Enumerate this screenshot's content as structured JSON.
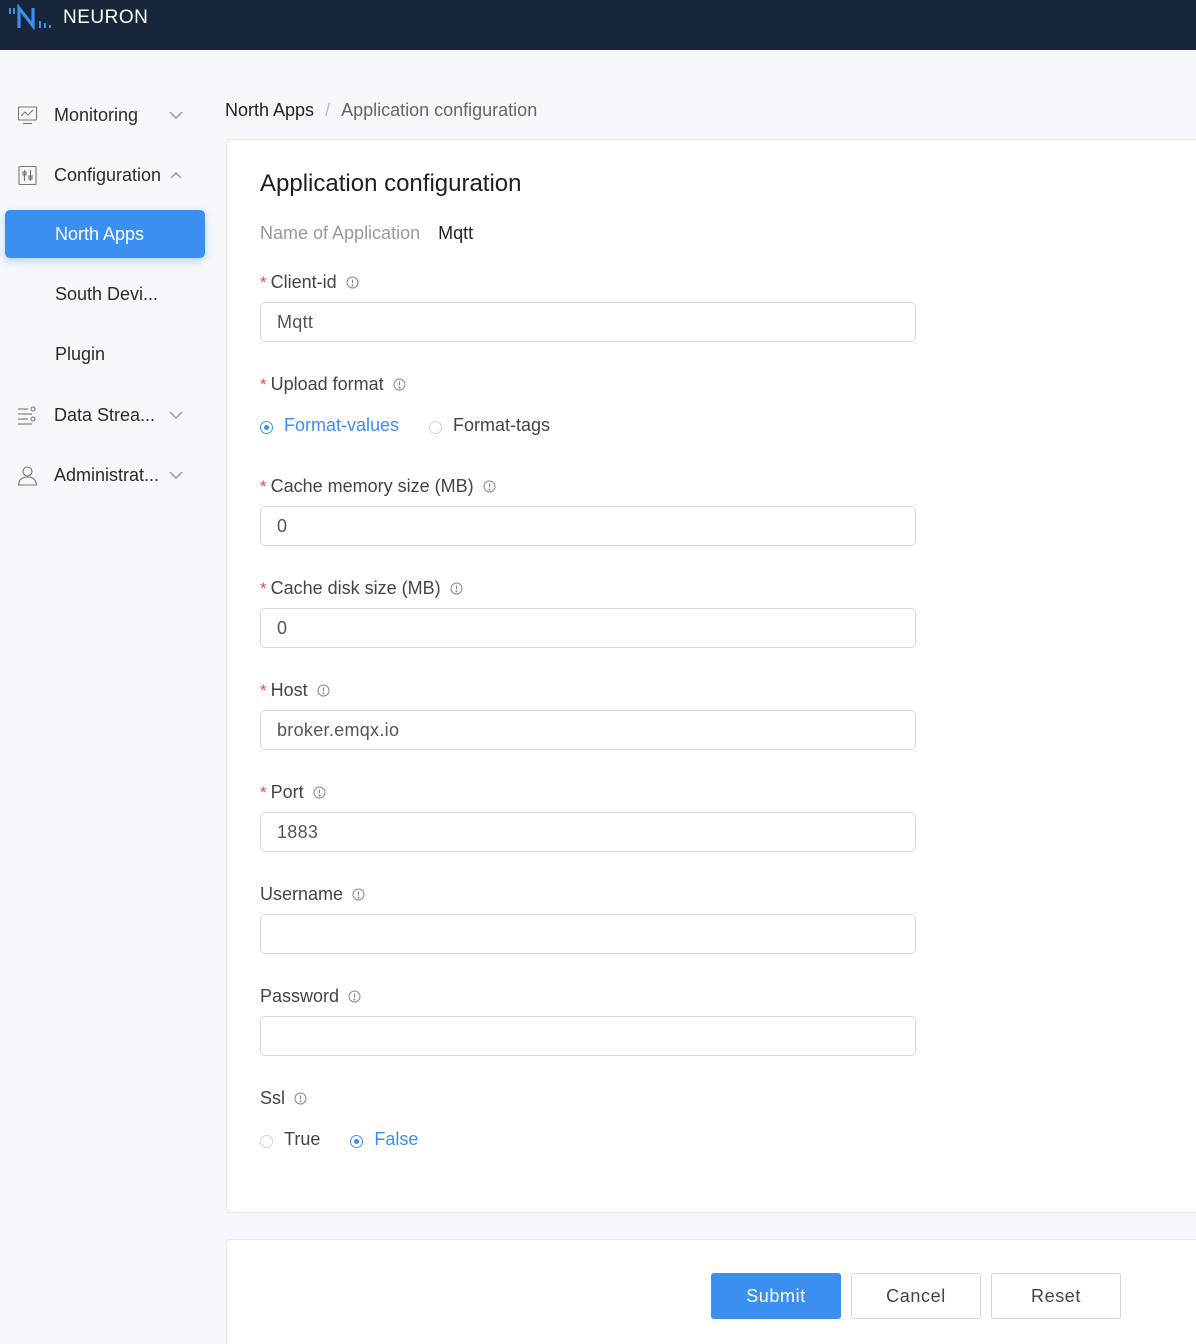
{
  "app": {
    "brand": "NEURON"
  },
  "sidebar": {
    "groups": [
      {
        "label": "Monitoring",
        "icon": "monitor-chart-icon",
        "expanded": false
      },
      {
        "label": "Configuration",
        "icon": "config-sliders-icon",
        "expanded": true
      },
      {
        "label": "Data Strea...",
        "icon": "data-stream-icon",
        "expanded": false
      },
      {
        "label": "Administrat...",
        "icon": "user-icon",
        "expanded": false
      }
    ],
    "config_items": [
      {
        "label": "North Apps",
        "active": true
      },
      {
        "label": "South Devi...",
        "active": false
      },
      {
        "label": "Plugin",
        "active": false
      }
    ]
  },
  "breadcrumb": {
    "parent": "North Apps",
    "separator": "/",
    "current": "Application configuration"
  },
  "form": {
    "title": "Application configuration",
    "app_name_label": "Name of Application",
    "app_name_value": "Mqtt",
    "fields": {
      "client_id": {
        "label": "Client-id",
        "required": true,
        "value": "Mqtt"
      },
      "upload_format": {
        "label": "Upload format",
        "required": true,
        "options": [
          "Format-values",
          "Format-tags"
        ],
        "selected": "Format-values"
      },
      "cache_memory": {
        "label": "Cache memory size (MB)",
        "required": true,
        "value": "0"
      },
      "cache_disk": {
        "label": "Cache disk size (MB)",
        "required": true,
        "value": "0"
      },
      "host": {
        "label": "Host",
        "required": true,
        "value": "broker.emqx.io"
      },
      "port": {
        "label": "Port",
        "required": true,
        "value": "1883"
      },
      "username": {
        "label": "Username",
        "required": false,
        "value": ""
      },
      "password": {
        "label": "Password",
        "required": false,
        "value": ""
      },
      "ssl": {
        "label": "Ssl",
        "required": false,
        "options": [
          "True",
          "False"
        ],
        "selected": "False"
      }
    },
    "required_mark": "*"
  },
  "actions": {
    "submit": "Submit",
    "cancel": "Cancel",
    "reset": "Reset"
  },
  "colors": {
    "header_bg": "#17263a",
    "accent": "#3b8ff0",
    "required": "#e74c3c"
  }
}
